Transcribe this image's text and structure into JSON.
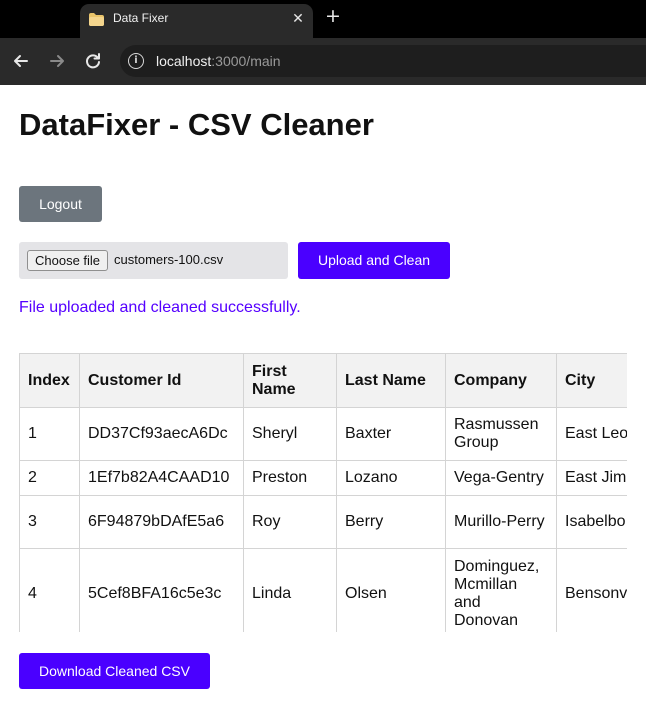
{
  "browser": {
    "tab_title": "Data Fixer",
    "tab_close": "✕",
    "new_tab": "+",
    "url_host": "localhost",
    "url_rest": ":3000/main"
  },
  "page": {
    "title": "DataFixer - CSV Cleaner",
    "logout_label": "Logout",
    "file_button_label": "Choose file",
    "file_name": "customers-100.csv",
    "upload_label": "Upload and Clean",
    "status_message": "File uploaded and cleaned successfully.",
    "download_label": "Download Cleaned CSV"
  },
  "table": {
    "headers": [
      "Index",
      "Customer Id",
      "First Name",
      "Last Name",
      "Company",
      "City"
    ],
    "rows": [
      [
        "1",
        "DD37Cf93aecA6Dc",
        "Sheryl",
        "Baxter",
        "Rasmussen Group",
        "East Leo"
      ],
      [
        "2",
        "1Ef7b82A4CAAD10",
        "Preston",
        "Lozano",
        "Vega-Gentry",
        "East Jim"
      ],
      [
        "3",
        "6F94879bDAfE5a6",
        "Roy",
        "Berry",
        "Murillo-Perry",
        "Isabelbo"
      ],
      [
        "4",
        "5Cef8BFA16c5e3c",
        "Linda",
        "Olsen",
        "Dominguez, Mcmillan and Donovan",
        "Bensonv"
      ]
    ]
  },
  "colors": {
    "accent": "#4a00ff",
    "logout_bg": "#6c757d",
    "status_text": "#5500ff"
  }
}
